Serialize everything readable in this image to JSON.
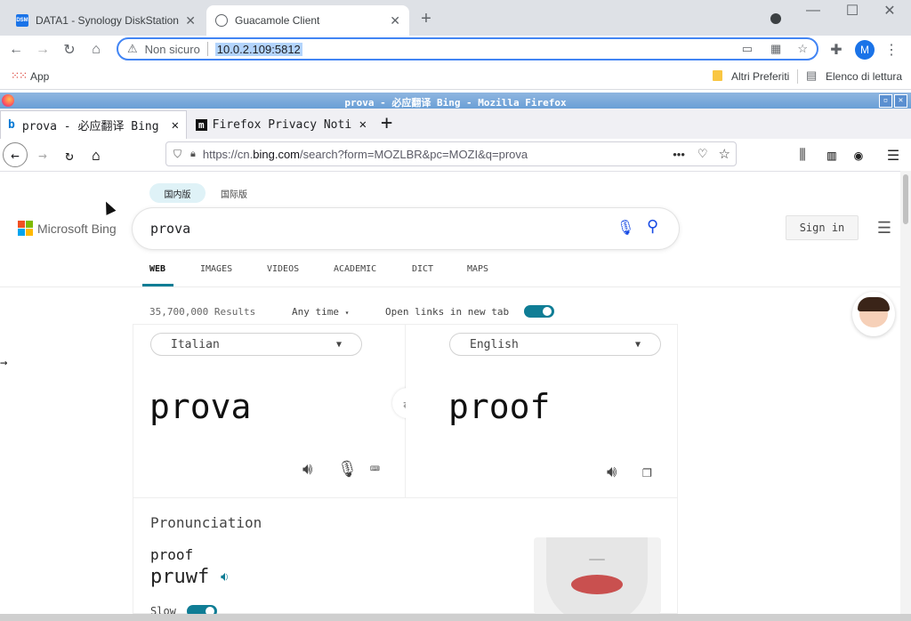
{
  "chrome": {
    "tabs": [
      {
        "favicon": "DSM",
        "title": "DATA1 - Synology DiskStation",
        "active": false
      },
      {
        "favicon": "guacamole-icon",
        "title": "Guacamole Client",
        "active": true
      }
    ],
    "security_label": "Non sicuro",
    "url": "10.0.2.109:5812",
    "profile_initial": "M",
    "bookmarks": {
      "apps_label": "App",
      "other_favorites": "Altri Preferiti",
      "reading_list": "Elenco di lettura"
    }
  },
  "firefox": {
    "window_title": "prova - 必应翻译 Bing - Mozilla Firefox",
    "tabs": [
      {
        "title": "prova - 必应翻译 Bing",
        "active": true
      },
      {
        "title": "Firefox Privacy Noti",
        "active": false
      }
    ],
    "url_prefix": "https://cn.",
    "url_domain": "bing.com",
    "url_path": "/search?form=MOZLBR&pc=MOZI&q=prova"
  },
  "bing": {
    "scope_tabs": [
      "国内版",
      "国际版"
    ],
    "logo_text": "Microsoft Bing",
    "query": "prova",
    "sign_in_label": "Sign in",
    "nav_tabs": [
      {
        "label": "WEB",
        "active": true
      },
      {
        "label": "IMAGES",
        "active": false
      },
      {
        "label": "VIDEOS",
        "active": false
      },
      {
        "label": "ACADEMIC",
        "active": false
      },
      {
        "label": "DICT",
        "active": false
      },
      {
        "label": "MAPS",
        "active": false
      }
    ],
    "results_count": "35,700,000 Results",
    "time_filter": "Any time",
    "open_links_label": "Open links in new tab",
    "open_links_on": true,
    "translator": {
      "source_lang": "Italian",
      "target_lang": "English",
      "source_text": "prova",
      "target_text": "proof"
    },
    "pronunciation": {
      "heading": "Pronunciation",
      "word": "proof",
      "phonetic": "pruwf",
      "slow_label": "Slow"
    }
  },
  "colors": {
    "accent": "#0f7d95",
    "chrome_focus": "#4285f4",
    "bing_blue": "#174ae4"
  }
}
